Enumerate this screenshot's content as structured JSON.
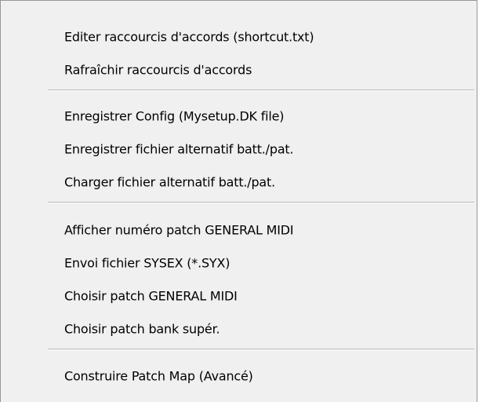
{
  "menu": {
    "groups": [
      {
        "items": [
          {
            "label": "Editer raccourcis d'accords (shortcut.txt)"
          },
          {
            "label": "Rafraîchir raccourcis d'accords"
          }
        ]
      },
      {
        "items": [
          {
            "label": "Enregistrer Config (Mysetup.DK file)"
          },
          {
            "label": "Enregistrer fichier alternatif batt./pat."
          },
          {
            "label": "Charger fichier alternatif batt./pat."
          }
        ]
      },
      {
        "items": [
          {
            "label": "Afficher numéro patch GENERAL MIDI"
          },
          {
            "label": "Envoi fichier SYSEX (*.SYX)"
          },
          {
            "label": "Choisir patch GENERAL MIDI"
          },
          {
            "label": "Choisir patch bank supér."
          }
        ]
      },
      {
        "items": [
          {
            "label": "Construire Patch Map (Avancé)"
          }
        ]
      }
    ]
  }
}
